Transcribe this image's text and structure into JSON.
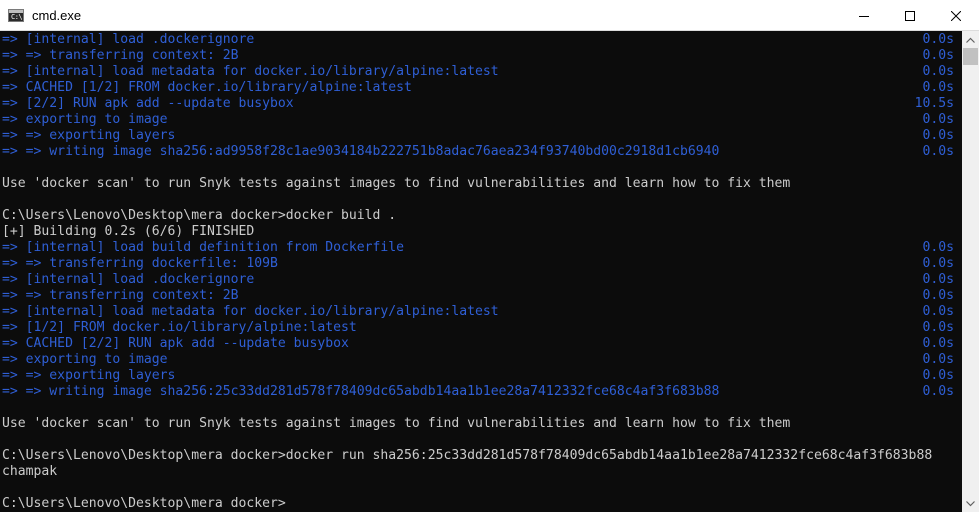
{
  "window": {
    "title": "cmd.exe",
    "app_icon_label": "C:\\"
  },
  "colors": {
    "terminal_bg": "#0c0c0c",
    "text_white": "#cccccc",
    "text_blue": "#2f5fd6"
  },
  "terminal": {
    "lines": [
      {
        "text": "=> [internal] load .dockerignore",
        "time": "0.0s",
        "color": "blue"
      },
      {
        "text": "=> => transferring context: 2B",
        "time": "0.0s",
        "color": "blue"
      },
      {
        "text": "=> [internal] load metadata for docker.io/library/alpine:latest",
        "time": "0.0s",
        "color": "blue"
      },
      {
        "text": "=> CACHED [1/2] FROM docker.io/library/alpine:latest",
        "time": "0.0s",
        "color": "blue"
      },
      {
        "text": "=> [2/2] RUN apk add --update busybox",
        "time": "10.5s",
        "color": "blue"
      },
      {
        "text": "=> exporting to image",
        "time": "0.0s",
        "color": "blue"
      },
      {
        "text": "=> => exporting layers",
        "time": "0.0s",
        "color": "blue"
      },
      {
        "text": "=> => writing image sha256:ad9958f28c1ae9034184b222751b8adac76aea234f93740bd00c2918d1cb6940",
        "time": "0.0s",
        "color": "blue"
      },
      {
        "text": "",
        "time": "",
        "color": "white"
      },
      {
        "text": "Use 'docker scan' to run Snyk tests against images to find vulnerabilities and learn how to fix them",
        "time": "",
        "color": "white"
      },
      {
        "text": "",
        "time": "",
        "color": "white"
      },
      {
        "text": "C:\\Users\\Lenovo\\Desktop\\mera docker>docker build .",
        "time": "",
        "color": "white"
      },
      {
        "text": "[+] Building 0.2s (6/6) FINISHED",
        "time": "",
        "color": "white"
      },
      {
        "text": "=> [internal] load build definition from Dockerfile",
        "time": "0.0s",
        "color": "blue"
      },
      {
        "text": "=> => transferring dockerfile: 109B",
        "time": "0.0s",
        "color": "blue"
      },
      {
        "text": "=> [internal] load .dockerignore",
        "time": "0.0s",
        "color": "blue"
      },
      {
        "text": "=> => transferring context: 2B",
        "time": "0.0s",
        "color": "blue"
      },
      {
        "text": "=> [internal] load metadata for docker.io/library/alpine:latest",
        "time": "0.0s",
        "color": "blue"
      },
      {
        "text": "=> [1/2] FROM docker.io/library/alpine:latest",
        "time": "0.0s",
        "color": "blue"
      },
      {
        "text": "=> CACHED [2/2] RUN apk add --update busybox",
        "time": "0.0s",
        "color": "blue"
      },
      {
        "text": "=> exporting to image",
        "time": "0.0s",
        "color": "blue"
      },
      {
        "text": "=> => exporting layers",
        "time": "0.0s",
        "color": "blue"
      },
      {
        "text": "=> => writing image sha256:25c33dd281d578f78409dc65abdb14aa1b1ee28a7412332fce68c4af3f683b88",
        "time": "0.0s",
        "color": "blue"
      },
      {
        "text": "",
        "time": "",
        "color": "white"
      },
      {
        "text": "Use 'docker scan' to run Snyk tests against images to find vulnerabilities and learn how to fix them",
        "time": "",
        "color": "white"
      },
      {
        "text": "",
        "time": "",
        "color": "white"
      },
      {
        "text": "C:\\Users\\Lenovo\\Desktop\\mera docker>docker run sha256:25c33dd281d578f78409dc65abdb14aa1b1ee28a7412332fce68c4af3f683b88",
        "time": "",
        "color": "white"
      },
      {
        "text": "champak",
        "time": "",
        "color": "white"
      },
      {
        "text": "",
        "time": "",
        "color": "white"
      },
      {
        "text": "C:\\Users\\Lenovo\\Desktop\\mera docker>",
        "time": "",
        "color": "white"
      }
    ]
  }
}
